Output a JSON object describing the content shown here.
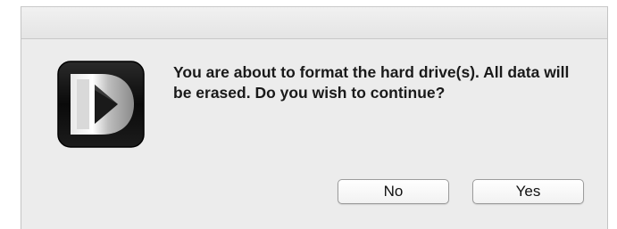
{
  "dialog": {
    "message": "You are about to format the hard drive(s). All data will be erased. Do you wish to continue?",
    "icon": "dlink-d-logo-icon"
  },
  "buttons": {
    "no_label": "No",
    "yes_label": "Yes"
  }
}
